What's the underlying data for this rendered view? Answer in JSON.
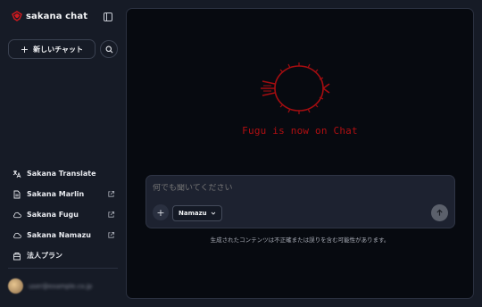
{
  "app": {
    "brand": "sakana chat",
    "accent": "#b10f12"
  },
  "sidebar": {
    "new_chat_label": "新しいチャット",
    "items": [
      {
        "label": "Sakana Translate",
        "icon": "translate-icon",
        "external": false
      },
      {
        "label": "Sakana Marlin",
        "icon": "document-icon",
        "external": true
      },
      {
        "label": "Sakana Fugu",
        "icon": "cloud-icon",
        "external": true
      },
      {
        "label": "Sakana Namazu",
        "icon": "cloud-icon",
        "external": true
      },
      {
        "label": "法人プラン",
        "icon": "building-icon",
        "external": false
      }
    ],
    "user_email": "user@example.co.jp"
  },
  "main": {
    "hero_title": "Fugu is now on Chat"
  },
  "composer": {
    "placeholder": "何でも聞いてください",
    "model": "Namazu",
    "disclaimer": "生成されたコンテンツは不正確または誤りを含む可能性があります。"
  }
}
